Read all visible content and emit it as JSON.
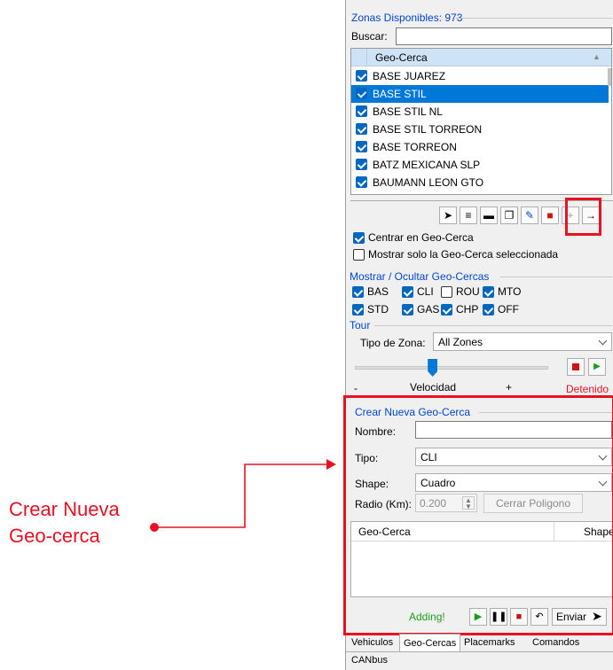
{
  "zonas": {
    "title": "Zonas Disponibles: 973",
    "search_label": "Buscar:",
    "search_value": "",
    "column_header": "Geo-Cerca",
    "items": [
      {
        "label": "BASE JUAREZ",
        "checked": true,
        "selected": false
      },
      {
        "label": "BASE STIL",
        "checked": true,
        "selected": true
      },
      {
        "label": "BASE STIL NL",
        "checked": true,
        "selected": false
      },
      {
        "label": "BASE STIL TORREON",
        "checked": true,
        "selected": false
      },
      {
        "label": "BASE TORREON",
        "checked": true,
        "selected": false
      },
      {
        "label": "BATZ MEXICANA SLP",
        "checked": true,
        "selected": false
      },
      {
        "label": "BAUMANN LEON GTO",
        "checked": true,
        "selected": false
      }
    ]
  },
  "toolbar": {
    "icons": [
      "navigate-icon",
      "filter-icon",
      "car-icon",
      "copy-icon",
      "edit-icon",
      "delete-icon",
      "add-icon",
      "arrow-right-icon"
    ],
    "glyphs": [
      "➤",
      "≡",
      "▬",
      "❐",
      "✎",
      "■",
      "+",
      "→"
    ]
  },
  "options": {
    "center": "Centrar en Geo-Cerca",
    "center_checked": true,
    "only_selected": "Mostrar solo la Geo-Cerca seleccionada",
    "only_selected_checked": false
  },
  "show_hide": {
    "title": "Mostrar / Ocultar Geo-Cercas",
    "types": [
      {
        "label": "BAS",
        "checked": true
      },
      {
        "label": "CLI",
        "checked": true
      },
      {
        "label": "ROU",
        "checked": false
      },
      {
        "label": "MTO",
        "checked": true
      },
      {
        "label": "STD",
        "checked": true
      },
      {
        "label": "GAS",
        "checked": true
      },
      {
        "label": "CHP",
        "checked": true
      },
      {
        "label": "OFF",
        "checked": true
      }
    ]
  },
  "tour": {
    "title": "Tour",
    "zone_type_label": "Tipo de Zona:",
    "zone_type_value": "All Zones",
    "minus": "-",
    "speed_label": "Velocidad",
    "plus": "+",
    "status": "Detenido",
    "slider_level": 0.4
  },
  "create": {
    "title": "Crear Nueva Geo-Cerca",
    "name_label": "Nombre:",
    "name_value": "",
    "type_label": "Tipo:",
    "type_value": "CLI",
    "shape_label": "Shape:",
    "shape_value": "Cuadro",
    "radius_label": "Radio (Km):",
    "radius_value": "0.200",
    "close_polygon": "Cerrar Poligono",
    "table_col1": "Geo-Cerca",
    "table_col2": "Shape",
    "status": "Adding!",
    "send": "Enviar"
  },
  "tabs": [
    "Vehiculos",
    "Geo-Cercas",
    "Placemarks",
    "Comandos",
    "CANbus"
  ],
  "annotation": {
    "line1": "Crear Nueva",
    "line2": "Geo-cerca"
  },
  "colors": {
    "accent": "#0078d7",
    "group_title": "#0046d5",
    "annotation": "#e81123",
    "status_green": "#1a9e1a",
    "status_red": "#e81123"
  }
}
